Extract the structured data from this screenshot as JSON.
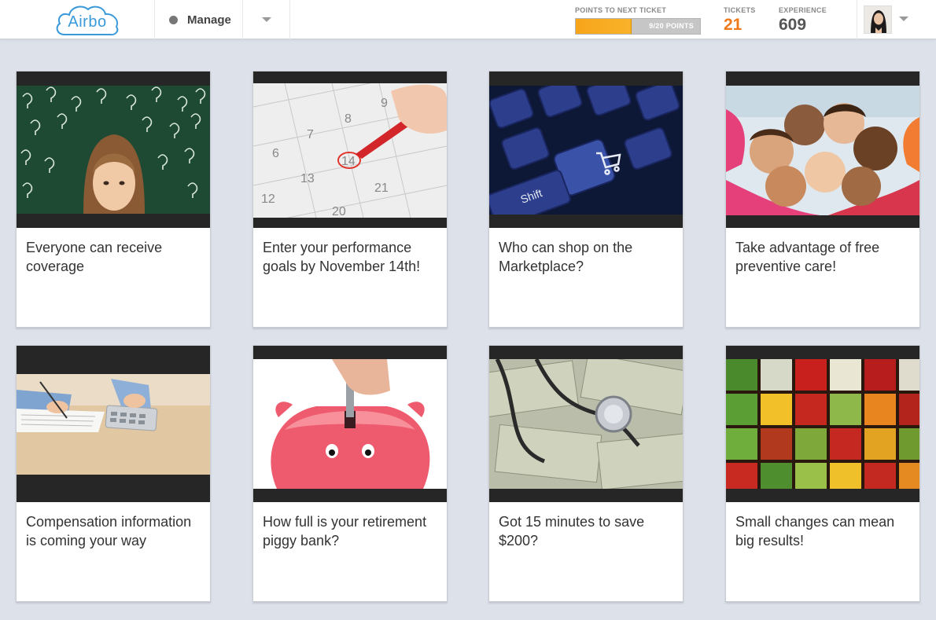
{
  "app": {
    "logo_text": "Airbo"
  },
  "nav": {
    "manage_label": "Manage"
  },
  "points": {
    "caption": "POINTS TO NEXT TICKET",
    "label": "9/20 POINTS",
    "current": 9,
    "total": 20,
    "progress_fraction": 0.45
  },
  "tickets": {
    "caption": "TICKETS",
    "value": "21"
  },
  "experience": {
    "caption": "EXPERIENCE",
    "value": "609"
  },
  "colors": {
    "accent_orange": "#f07a1a",
    "brand_blue": "#3a9ad9",
    "background": "#dde1ea"
  },
  "tiles": [
    {
      "title": "Everyone can receive coverage",
      "image": "woman-with-question-marks"
    },
    {
      "title": "Enter your performance goals by November 14th!",
      "image": "calendar-circled-date"
    },
    {
      "title": "Who can shop on the Marketplace?",
      "image": "keyboard-cart-key"
    },
    {
      "title": "Take advantage of free preventive care!",
      "image": "children-circle"
    },
    {
      "title": "Compensation information is coming your way",
      "image": "calculator-paperwork"
    },
    {
      "title": "How full is your retirement piggy bank?",
      "image": "piggy-bank-coin"
    },
    {
      "title": "Got 15 minutes to save $200?",
      "image": "stethoscope-money"
    },
    {
      "title": "Small changes can mean big results!",
      "image": "vegetable-grid"
    }
  ]
}
